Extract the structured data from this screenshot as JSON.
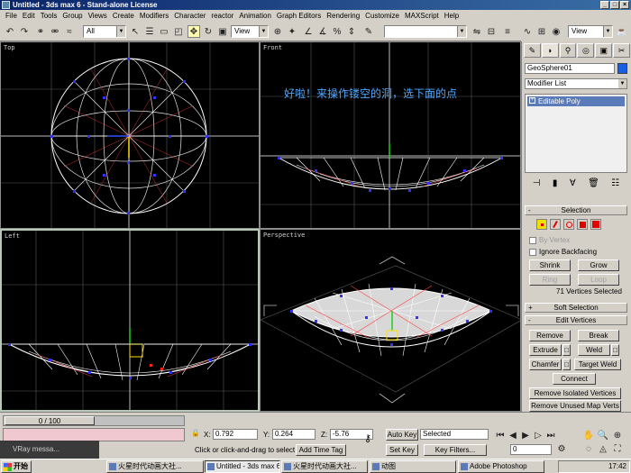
{
  "window": {
    "title": "Untitled - 3ds max 6 - Stand-alone License"
  },
  "menu": [
    "File",
    "Edit",
    "Tools",
    "Group",
    "Views",
    "Create",
    "Modifiers",
    "Character",
    "reactor",
    "Animation",
    "Graph Editors",
    "Rendering",
    "Customize",
    "MAXScript",
    "Help"
  ],
  "toolbar": {
    "selection_filter": "All",
    "ref_coord": "View",
    "right_coord": "View"
  },
  "viewports": {
    "top": "Top",
    "front": "Front",
    "left": "Left",
    "perspective": "Perspective"
  },
  "annotation": "好啦！来操作镂空的洞，选下面的点",
  "command_panel": {
    "object_name": "GeoSphere01",
    "modifier_list": "Modifier List",
    "stack_item": "Editable Poly",
    "selection_header": "Selection",
    "by_vertex": "By Vertex",
    "ignore_backfacing": "Ignore Backfacing",
    "shrink": "Shrink",
    "grow": "Grow",
    "ring": "Ring",
    "loop": "Loop",
    "selected_info": "71 Vertices Selected",
    "soft_selection": "Soft Selection",
    "edit_vertices": "Edit Vertices",
    "remove": "Remove",
    "break": "Break",
    "extrude": "Extrude",
    "weld": "Weld",
    "chamfer": "Chamfer",
    "target_weld": "Target Weld",
    "connect": "Connect",
    "remove_isolated": "Remove Isolated Vertices",
    "remove_unused": "Remove Unused Map Verts"
  },
  "bottom": {
    "frame": "0 / 100",
    "x_label": "X:",
    "x": "0.792",
    "y_label": "Y:",
    "y": "0.264",
    "z_label": "Z:",
    "z": "-5.76",
    "auto_key": "Auto Key",
    "selected": "Selected",
    "set_key": "Set Key",
    "key_filters": "Key Filters...",
    "frame_field": "0",
    "status": "Click or click-and-drag to select obj",
    "add_time_tag": "Add Time Tag",
    "vray": "VRay messa..."
  },
  "taskbar": {
    "start": "开始",
    "tasks": [
      "火星时代动画大社...",
      "Untitled - 3ds max 6 -...",
      "火星时代动画大社...",
      "动图",
      "Adobe Photoshop"
    ],
    "clock": "17:42"
  },
  "colors": {
    "accent": "#0a246a",
    "annotation": "#4da6ff",
    "object_color": "#1a5ee0",
    "vertex": "#3030ff",
    "selected_vertex": "#ff2020"
  }
}
